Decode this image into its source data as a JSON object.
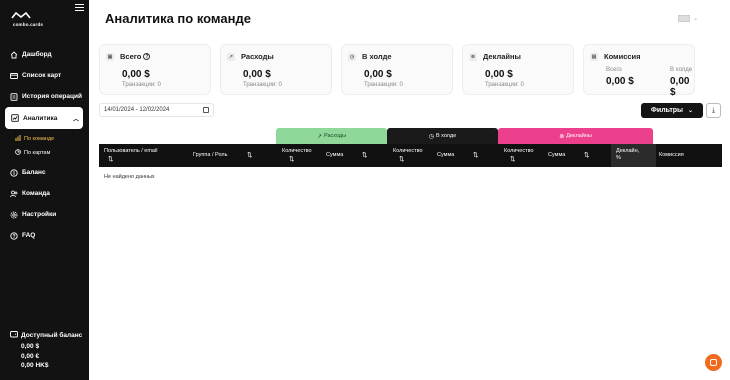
{
  "brand": {
    "name": "combo.cards"
  },
  "sidebar": {
    "items": [
      {
        "label": "Дашборд",
        "icon": "dashboard-icon"
      },
      {
        "label": "Список карт",
        "icon": "cards-icon"
      },
      {
        "label": "История операций",
        "icon": "history-icon"
      },
      {
        "label": "Аналитика",
        "icon": "analytics-icon"
      },
      {
        "label": "Баланс",
        "icon": "balance-icon"
      },
      {
        "label": "Команда",
        "icon": "team-icon"
      },
      {
        "label": "Настройки",
        "icon": "settings-icon"
      },
      {
        "label": "FAQ",
        "icon": "faq-icon"
      }
    ],
    "subitems": [
      {
        "label": "По команде"
      },
      {
        "label": "По картам"
      }
    ],
    "balance": {
      "title": "Доступный баланс",
      "values": [
        "0,00 $",
        "0,00 €",
        "0,00 HK$"
      ]
    }
  },
  "header": {
    "title": "Аналитика по команде"
  },
  "cards": {
    "total": {
      "title": "Всего",
      "amount": "0,00 $",
      "sub": "Транзакции: 0"
    },
    "expenses": {
      "title": "Расходы",
      "amount": "0,00 $",
      "sub": "Транзакции: 0"
    },
    "hold": {
      "title": "В холде",
      "amount": "0,00 $",
      "sub": "Транзакции: 0"
    },
    "declines": {
      "title": "Деклайны",
      "amount": "0,00 $",
      "sub": "Транзакции: 0"
    },
    "commission": {
      "title": "Комиссия",
      "total_label": "Всего",
      "total_amount": "0,00 $",
      "hold_label": "В холде",
      "hold_amount": "0,00 $"
    }
  },
  "filters": {
    "date_range": "14/01/2024 - 12/02/2024",
    "filters_label": "Фильтры"
  },
  "tabs": {
    "expenses": "Расходы",
    "hold": "В холде",
    "declines": "Деклайны"
  },
  "table": {
    "col_user": "Пользователь / email",
    "col_group": "Группа / Роль",
    "col_exp_qty": "Количество",
    "col_exp_sum": "Сумма",
    "col_hold_qty": "Количество",
    "col_hold_sum": "Сумма",
    "col_dec_qty": "Количество",
    "col_dec_sum": "Сумма",
    "col_dec_pct_1": "Деклайн,",
    "col_dec_pct_2": "%",
    "col_commission": "Комиссия",
    "empty": "Не найдено данных"
  },
  "colors": {
    "sidebar_bg": "#121212",
    "accent_orange": "#f26b1d",
    "tab_expenses": "#8fd89a",
    "tab_hold": "#1a1a1a",
    "tab_declines": "#ec3f8c",
    "active_sub": "#f5c04a"
  }
}
